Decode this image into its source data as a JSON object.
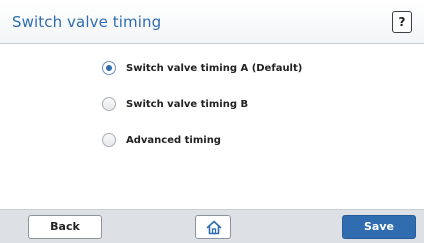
{
  "header": {
    "title": "Switch valve timing",
    "help_label": "?"
  },
  "options": [
    {
      "label": "Switch valve timing A (Default)",
      "selected": true
    },
    {
      "label": "Switch valve timing B",
      "selected": false
    },
    {
      "label": "Advanced timing",
      "selected": false
    }
  ],
  "footer": {
    "back_label": "Back",
    "home_icon": "home-icon",
    "save_label": "Save"
  },
  "colors": {
    "accent": "#2f6db0",
    "footer_bg": "#dde1e5"
  }
}
